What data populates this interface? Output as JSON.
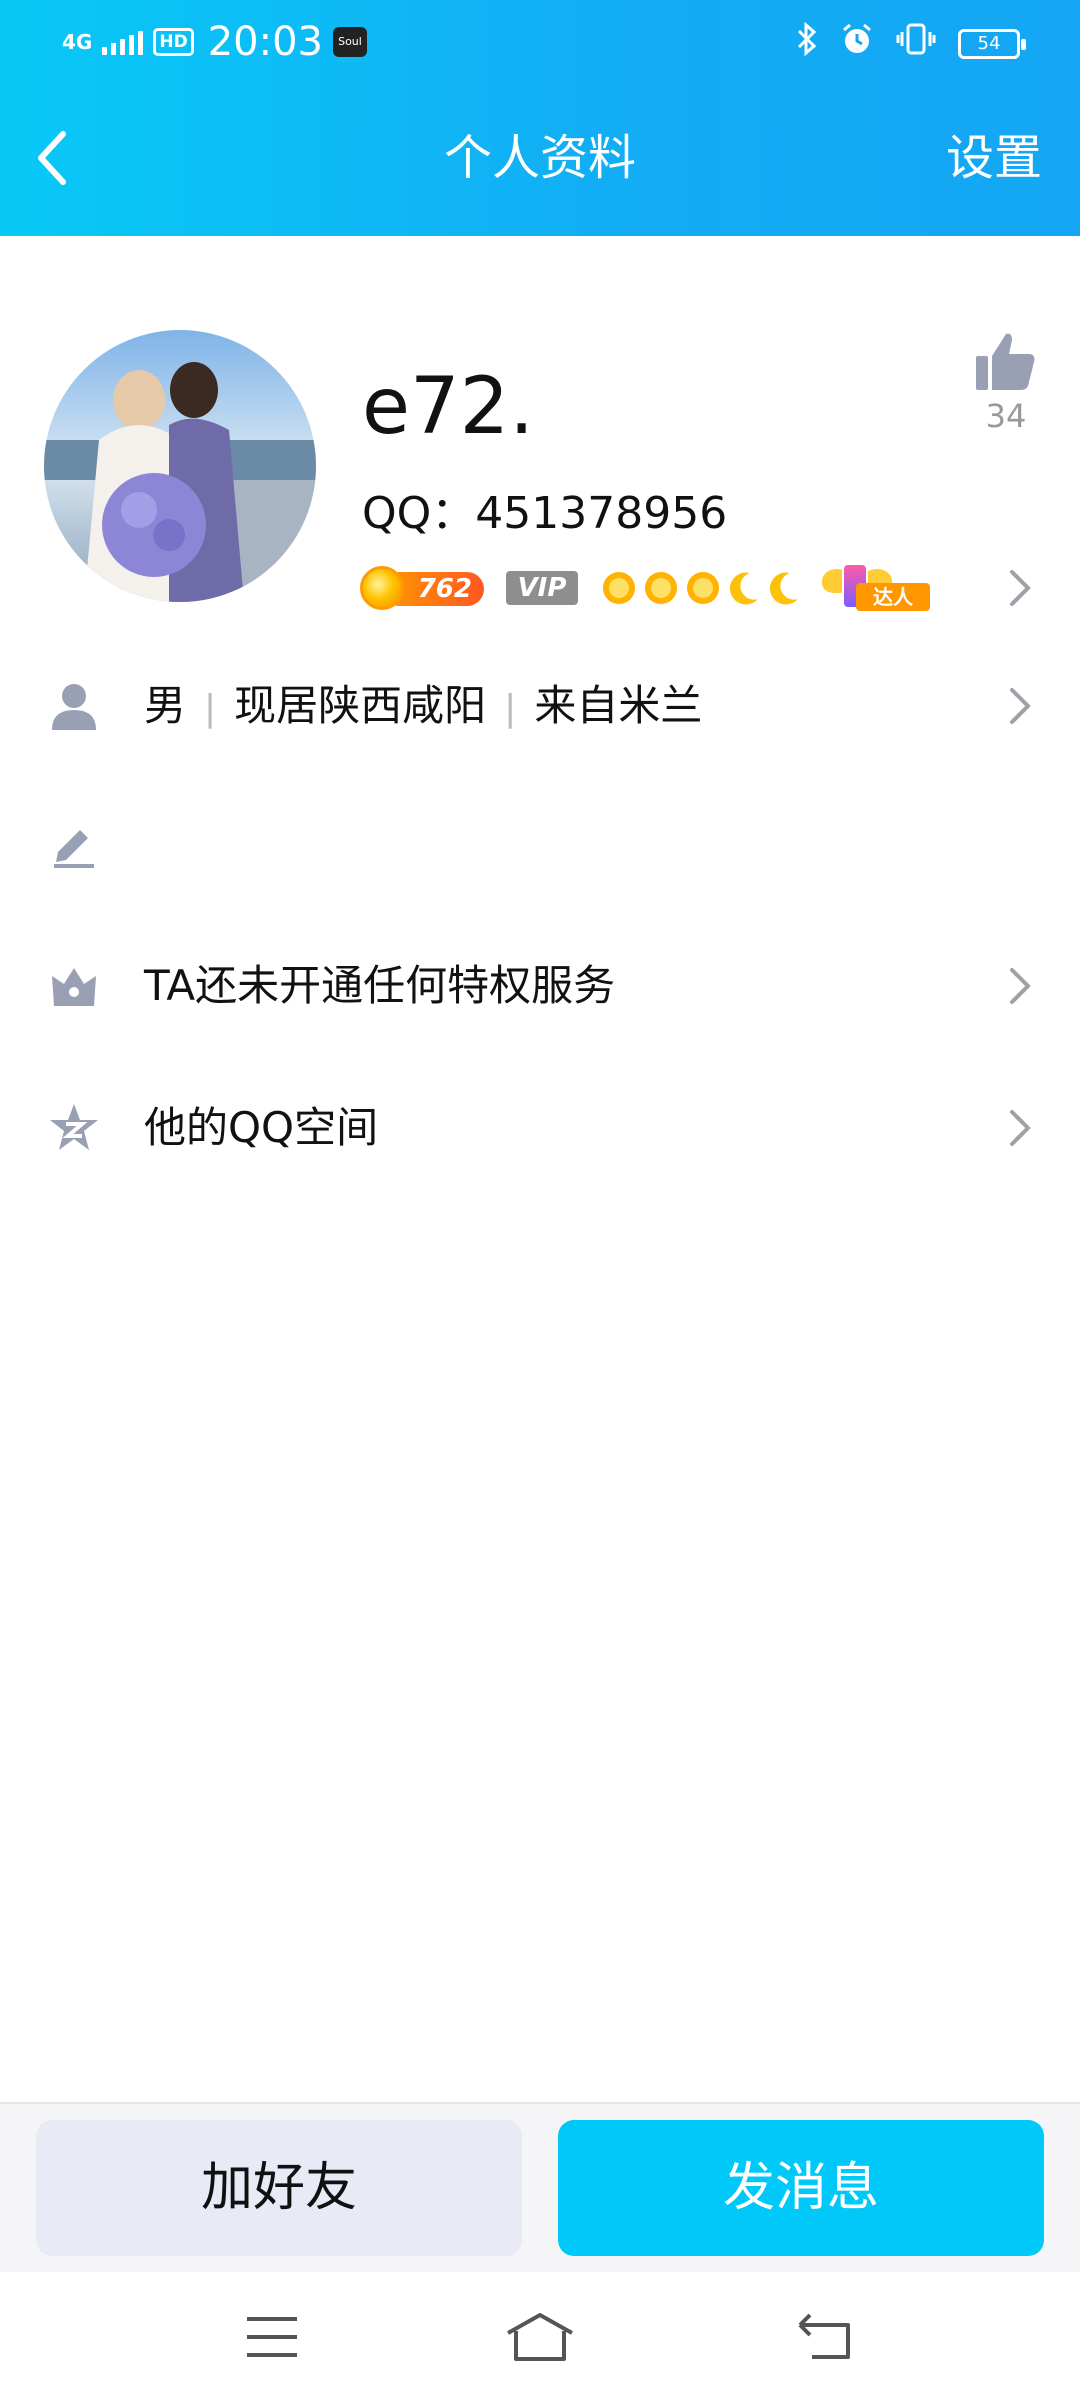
{
  "status_bar": {
    "network": "4G",
    "hd": "HD",
    "time": "20:03",
    "app_badge": "Soul",
    "battery": "54"
  },
  "header": {
    "title": "个人资料",
    "settings_label": "设置"
  },
  "profile": {
    "nickname": "e72.",
    "qq_label": "QQ：451378956",
    "like_count": "34",
    "level_number": "762",
    "vip_label": "VIP",
    "talent_tag": "达人",
    "level_icons": [
      "sun-icon",
      "sun-icon",
      "sun-icon",
      "moon-icon",
      "moon-icon"
    ]
  },
  "info_rows": {
    "gender": "男",
    "location": "现居陕西咸阳",
    "hometown": "来自米兰",
    "privilege": "TA还未开通任何特权服务",
    "qzone": "他的QQ空间"
  },
  "actions": {
    "add_friend": "加好友",
    "send_message": "发消息"
  },
  "colors": {
    "header_gradient_start": "#08c9f6",
    "header_gradient_end": "#14a6f4",
    "primary_button": "#00c8f8",
    "secondary_button": "#e8ebf5",
    "icon_gray": "#9aa0b4"
  }
}
